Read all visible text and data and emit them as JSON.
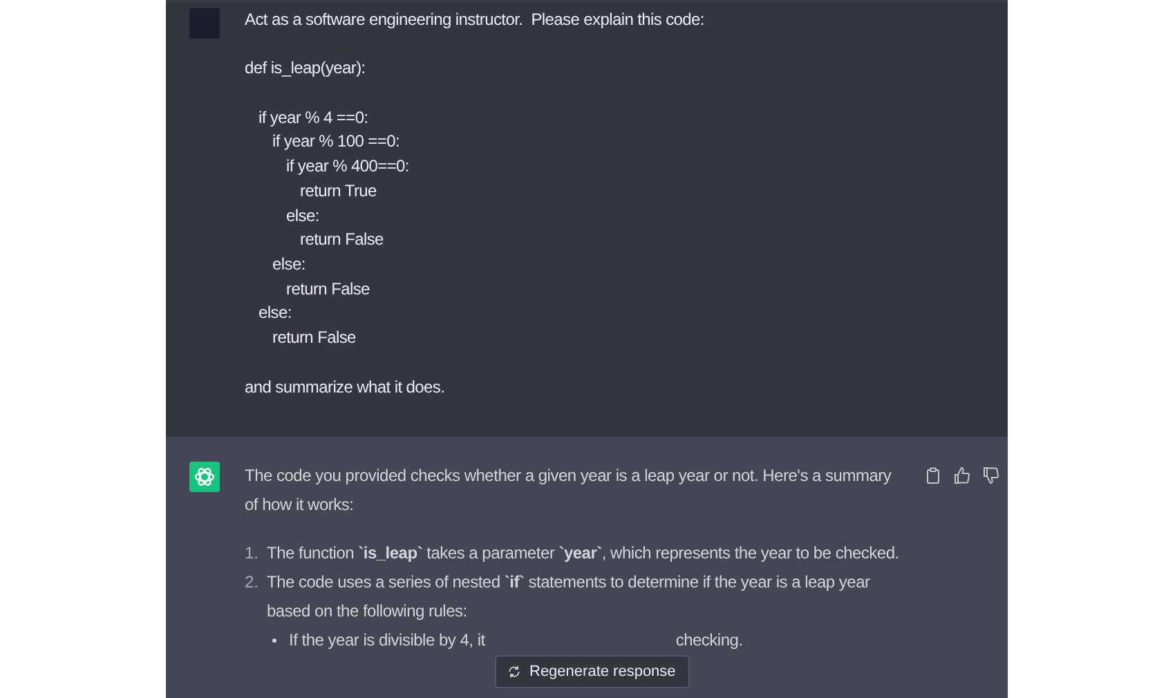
{
  "prompt": {
    "intro": "Act as a software engineering instructor.  Please explain this code:",
    "code": [
      {
        "text": "def is_leap(year):",
        "children": [
          {
            "text": "if year % 4 ==0:",
            "children": [
              {
                "text": "if year % 100 ==0:",
                "children": [
                  {
                    "text": "if year % 400==0:",
                    "children": [
                      {
                        "text": "return True"
                      }
                    ]
                  },
                  {
                    "text": "else:",
                    "children": [
                      {
                        "text": "return False"
                      }
                    ]
                  }
                ]
              },
              {
                "text": "else:",
                "children": [
                  {
                    "text": "return False"
                  }
                ]
              }
            ]
          },
          {
            "text": "else:",
            "children": [
              {
                "text": "return False"
              }
            ]
          }
        ]
      }
    ],
    "outro": "and summarize what it does."
  },
  "answer": {
    "intro": "The code you provided checks whether a given year is a leap year or not. Here's a summary of how it works:",
    "steps": [
      {
        "number": "1.",
        "text": "The function **`is_leap`** takes a parameter **`year`**, which represents the year to be checked."
      },
      {
        "number": "2.",
        "text": "The code uses a series of nested **`if`** statements to determine if the year is a leap year based on the following rules:"
      }
    ],
    "bullets": [
      {
        "before": "If the year is divisible by 4, it",
        "after": "checking."
      }
    ]
  },
  "regenerate_button": "Regenerate response"
}
